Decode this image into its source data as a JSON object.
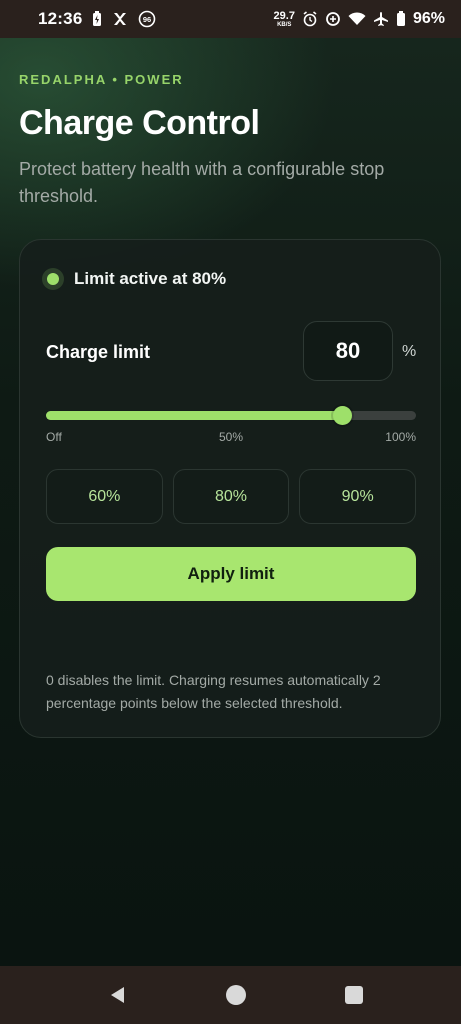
{
  "status_bar": {
    "time": "12:36",
    "net_speed_value": "29.7",
    "net_speed_unit": "KB/S",
    "battery_percent": "96%",
    "notification_badge": "96",
    "icons": [
      "battery-charging-icon",
      "app-notification-icon",
      "badge-96-icon",
      "alarm-icon",
      "data-saver-icon",
      "wifi-icon",
      "airplane-icon",
      "battery-icon"
    ]
  },
  "header": {
    "eyebrow": "REDALPHA • POWER",
    "title": "Charge Control",
    "subtitle": "Protect battery health with a configurable stop threshold."
  },
  "card": {
    "status_text": "Limit active at 80%",
    "limit_label": "Charge limit",
    "limit_value": "80",
    "unit": "%",
    "slider": {
      "value": 80,
      "min": 0,
      "max": 100,
      "min_label": "Off",
      "mid_label": "50%",
      "max_label": "100%"
    },
    "presets": [
      "60%",
      "80%",
      "90%"
    ],
    "apply_label": "Apply limit",
    "note": "0 disables the limit. Charging resumes automatically 2 percentage points below the selected threshold."
  },
  "colors": {
    "accent": "#9ee06a",
    "button": "#a8e66f",
    "background": "#0b1310",
    "card": "#161e1b"
  },
  "nav": {
    "icons": [
      "back-icon",
      "home-icon",
      "recents-icon"
    ]
  }
}
